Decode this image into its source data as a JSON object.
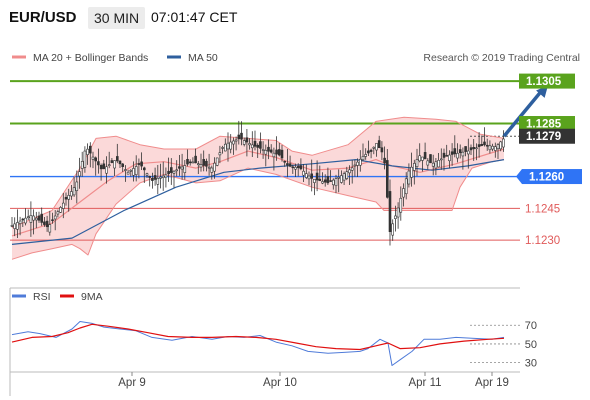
{
  "header": {
    "symbol": "EUR/USD",
    "timeframe": "30 MIN",
    "time": "07:01:47 CET"
  },
  "colors": {
    "bb_line": "#f08c8c",
    "bb_fill": "#fbd9d9",
    "ma50": "#2e5f9e",
    "green": "#5aa31d",
    "blue": "#2f74f5",
    "red": "#e05a5a",
    "dark": "#333333",
    "arrow": "#2e5f9e",
    "rsi_line": "#4f7bd9",
    "rsi_ma": "#e01010",
    "bull": "#333333",
    "bear": "#333333"
  },
  "legend_main": [
    {
      "label": "MA 20 + Bollinger Bands",
      "color": "#f08c8c"
    },
    {
      "label": "MA 50",
      "color": "#2e5f9e"
    }
  ],
  "legend_rsi": [
    {
      "label": "RSI",
      "color": "#4f7bd9"
    },
    {
      "label": "9MA",
      "color": "#e01010"
    }
  ],
  "watermark": "Research © 2019 Trading Central",
  "chart_data": [
    {
      "type": "candlestick",
      "title": "",
      "ylim": [
        1.1215,
        1.1314
      ],
      "x": [
        "Apr 9",
        "Apr 10",
        "Apr 11",
        "Apr 19"
      ],
      "levels": [
        {
          "value": 1.1305,
          "label": "1.1305",
          "style": "green"
        },
        {
          "value": 1.1285,
          "label": "1.1285",
          "style": "green"
        },
        {
          "value": 1.1279,
          "label": "1.1279",
          "style": "dark"
        },
        {
          "value": 1.126,
          "label": "1.1260",
          "style": "blue"
        },
        {
          "value": 1.1245,
          "label": "1.1245",
          "style": "red"
        },
        {
          "value": 1.123,
          "label": "1.1230",
          "style": "red"
        }
      ],
      "path": [
        [
          0,
          1.1237
        ],
        [
          10,
          1.1242
        ],
        [
          18,
          1.1236
        ],
        [
          26,
          1.1248
        ],
        [
          32,
          1.1256
        ],
        [
          37,
          1.1274
        ],
        [
          45,
          1.1263
        ],
        [
          52,
          1.1268
        ],
        [
          58,
          1.1262
        ],
        [
          64,
          1.1266
        ],
        [
          70,
          1.1258
        ],
        [
          80,
          1.1262
        ],
        [
          90,
          1.1267
        ],
        [
          100,
          1.1264
        ],
        [
          106,
          1.1275
        ],
        [
          114,
          1.1278
        ],
        [
          122,
          1.1274
        ],
        [
          128,
          1.1272
        ],
        [
          134,
          1.127
        ],
        [
          138,
          1.1265
        ],
        [
          144,
          1.1264
        ],
        [
          150,
          1.1259
        ],
        [
          158,
          1.1257
        ],
        [
          164,
          1.126
        ],
        [
          170,
          1.1264
        ],
        [
          176,
          1.127
        ],
        [
          180,
          1.1272
        ],
        [
          182,
          1.1276
        ],
        [
          186,
          1.127
        ],
        [
          189,
          1.1234
        ],
        [
          193,
          1.1245
        ],
        [
          198,
          1.1262
        ],
        [
          204,
          1.127
        ],
        [
          210,
          1.1266
        ],
        [
          218,
          1.127
        ],
        [
          228,
          1.1272
        ],
        [
          236,
          1.1275
        ],
        [
          242,
          1.1274
        ],
        [
          246,
          1.1278
        ]
      ],
      "ma20": [
        [
          0,
          1.1232
        ],
        [
          20,
          1.1238
        ],
        [
          34,
          1.1248
        ],
        [
          48,
          1.1258
        ],
        [
          62,
          1.1266
        ],
        [
          76,
          1.1267
        ],
        [
          92,
          1.1264
        ],
        [
          104,
          1.1267
        ],
        [
          118,
          1.1272
        ],
        [
          132,
          1.1269
        ],
        [
          150,
          1.1263
        ],
        [
          168,
          1.1264
        ],
        [
          182,
          1.1268
        ],
        [
          190,
          1.1265
        ],
        [
          204,
          1.1262
        ],
        [
          222,
          1.1266
        ],
        [
          246,
          1.1273
        ]
      ],
      "bb_upper": [
        [
          0,
          1.1236
        ],
        [
          20,
          1.1244
        ],
        [
          34,
          1.1264
        ],
        [
          42,
          1.1278
        ],
        [
          52,
          1.1279
        ],
        [
          64,
          1.1275
        ],
        [
          76,
          1.1273
        ],
        [
          92,
          1.1273
        ],
        [
          104,
          1.1279
        ],
        [
          118,
          1.1278
        ],
        [
          132,
          1.1277
        ],
        [
          140,
          1.1272
        ],
        [
          150,
          1.127
        ],
        [
          168,
          1.1275
        ],
        [
          182,
          1.1286
        ],
        [
          196,
          1.1288
        ],
        [
          212,
          1.1287
        ],
        [
          222,
          1.1286
        ],
        [
          234,
          1.128
        ],
        [
          246,
          1.1278
        ]
      ],
      "bb_lower": [
        [
          0,
          1.1221
        ],
        [
          10,
          1.1224
        ],
        [
          20,
          1.1226
        ],
        [
          30,
          1.1228
        ],
        [
          34,
          1.1226
        ],
        [
          38,
          1.1223
        ],
        [
          42,
          1.1233
        ],
        [
          52,
          1.1247
        ],
        [
          64,
          1.1257
        ],
        [
          76,
          1.1261
        ],
        [
          92,
          1.1257
        ],
        [
          104,
          1.1258
        ],
        [
          118,
          1.1264
        ],
        [
          132,
          1.1261
        ],
        [
          150,
          1.1255
        ],
        [
          168,
          1.1251
        ],
        [
          182,
          1.1248
        ],
        [
          186,
          1.1244
        ],
        [
          200,
          1.1244
        ],
        [
          214,
          1.1244
        ],
        [
          220,
          1.1244
        ],
        [
          224,
          1.1255
        ],
        [
          230,
          1.1264
        ],
        [
          240,
          1.1267
        ],
        [
          246,
          1.1268
        ]
      ],
      "ma50": [
        [
          0,
          1.1228
        ],
        [
          30,
          1.1231
        ],
        [
          56,
          1.1244
        ],
        [
          82,
          1.1255
        ],
        [
          106,
          1.1262
        ],
        [
          124,
          1.1264
        ],
        [
          150,
          1.1266
        ],
        [
          172,
          1.1268
        ],
        [
          190,
          1.1265
        ],
        [
          210,
          1.1263
        ],
        [
          228,
          1.1265
        ],
        [
          246,
          1.1268
        ]
      ],
      "forecast_arrow": [
        [
          246,
          1.1279
        ],
        [
          268,
          1.1303
        ]
      ]
    },
    {
      "type": "line",
      "title": "",
      "ylim": [
        20,
        82
      ],
      "yticks": [
        70,
        50,
        30
      ],
      "reference_lines": [
        70,
        50,
        30
      ],
      "x_labels": [
        "Apr 9",
        "Apr 10",
        "Apr 11",
        "Apr 19"
      ],
      "series": [
        {
          "name": "RSI",
          "values": [
            [
              0,
              60
            ],
            [
              8,
              63
            ],
            [
              14,
              61
            ],
            [
              22,
              57
            ],
            [
              30,
              66
            ],
            [
              34,
              74
            ],
            [
              40,
              72
            ],
            [
              46,
              68
            ],
            [
              54,
              66
            ],
            [
              62,
              64
            ],
            [
              70,
              57
            ],
            [
              80,
              54
            ],
            [
              90,
              58
            ],
            [
              100,
              55
            ],
            [
              108,
              58
            ],
            [
              116,
              57
            ],
            [
              124,
              59
            ],
            [
              132,
              52
            ],
            [
              140,
              48
            ],
            [
              148,
              42
            ],
            [
              158,
              40
            ],
            [
              166,
              41
            ],
            [
              174,
              42
            ],
            [
              178,
              45
            ],
            [
              184,
              55
            ],
            [
              188,
              51
            ],
            [
              190,
              27
            ],
            [
              194,
              33
            ],
            [
              200,
              42
            ],
            [
              206,
              55
            ],
            [
              214,
              55
            ],
            [
              222,
              57
            ],
            [
              230,
              56
            ],
            [
              240,
              55
            ],
            [
              246,
              57
            ]
          ]
        },
        {
          "name": "9MA",
          "values": [
            [
              0,
              52
            ],
            [
              10,
              57
            ],
            [
              20,
              58
            ],
            [
              28,
              62
            ],
            [
              34,
              67
            ],
            [
              40,
              71
            ],
            [
              48,
              69
            ],
            [
              58,
              66
            ],
            [
              68,
              62
            ],
            [
              78,
              58
            ],
            [
              90,
              57
            ],
            [
              100,
              57
            ],
            [
              112,
              58
            ],
            [
              122,
              57
            ],
            [
              132,
              55
            ],
            [
              142,
              51
            ],
            [
              152,
              47
            ],
            [
              162,
              45
            ],
            [
              174,
              44
            ],
            [
              182,
              48
            ],
            [
              188,
              51
            ],
            [
              194,
              45
            ],
            [
              204,
              46
            ],
            [
              214,
              50
            ],
            [
              226,
              53
            ],
            [
              238,
              55
            ],
            [
              246,
              56
            ]
          ]
        }
      ]
    }
  ]
}
